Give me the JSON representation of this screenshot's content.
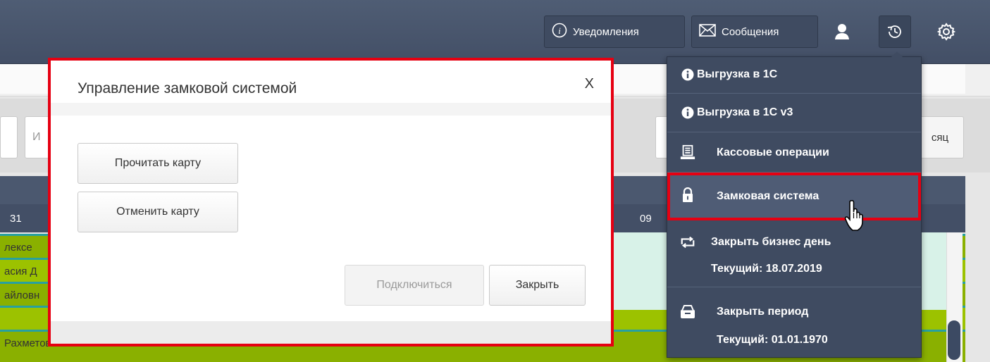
{
  "topbar": {
    "notifications_label": "Уведомления",
    "messages_label": "Сообщения"
  },
  "background": {
    "input_ghost": "И",
    "right_button_label": "сяц",
    "date_left": "31",
    "date_right": "09",
    "rows": [
      "лексе",
      "асия Д",
      "айловн",
      "",
      "Рахметовна"
    ]
  },
  "modal": {
    "title": "Управление замковой системой",
    "close_label": "X",
    "read_card_label": "Прочитать карту",
    "cancel_card_label": "Отменить карту",
    "connect_label": "Подключиться",
    "close_button_label": "Закрыть"
  },
  "menu": {
    "items": [
      {
        "label": "Выгрузка в 1С",
        "icon": "info-icon"
      },
      {
        "label": "Выгрузка в 1С v3",
        "icon": "info-icon"
      },
      {
        "label": "Кассовые операции",
        "icon": "cash-register-icon"
      },
      {
        "label": "Замковая система",
        "icon": "lock-icon"
      },
      {
        "label": "Закрыть бизнес день",
        "sub": "Текущий: 18.07.2019",
        "icon": "refresh-icon"
      },
      {
        "label": "Закрыть период",
        "sub": "Текущий: 01.01.1970",
        "icon": "archive-icon"
      }
    ]
  },
  "colors": {
    "highlight": "#e60012",
    "menu_bg": "#3f4b61",
    "topbar_bg": "#4a576e"
  }
}
